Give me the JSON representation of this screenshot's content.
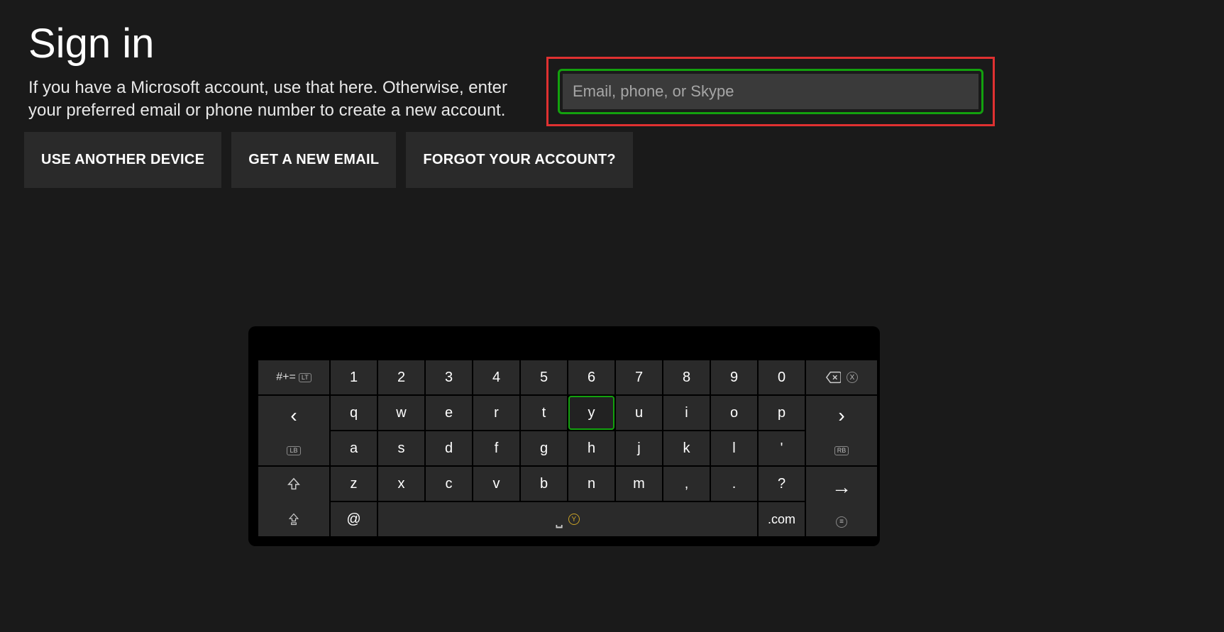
{
  "header": {
    "title": "Sign in",
    "subtitle": "If you have a Microsoft account, use that here. Otherwise, enter your preferred email or phone number to create a new account."
  },
  "buttons": {
    "another_device": "USE ANOTHER DEVICE",
    "new_email": "GET A NEW EMAIL",
    "forgot": "FORGOT YOUR ACCOUNT?"
  },
  "input": {
    "placeholder": "Email, phone, or Skype",
    "value": ""
  },
  "keyboard": {
    "symbol_mode_label": "#+=",
    "lt_badge": "LT",
    "lb_badge": "LB",
    "rb_badge": "RB",
    "x_badge": "X",
    "y_badge": "Y",
    "row1": [
      "1",
      "2",
      "3",
      "4",
      "5",
      "6",
      "7",
      "8",
      "9",
      "0"
    ],
    "row2": [
      "q",
      "w",
      "e",
      "r",
      "t",
      "y",
      "u",
      "i",
      "o",
      "p"
    ],
    "row3": [
      "a",
      "s",
      "d",
      "f",
      "g",
      "h",
      "j",
      "k",
      "l",
      "'"
    ],
    "row4": [
      "z",
      "x",
      "c",
      "v",
      "b",
      "n",
      "m",
      ",",
      ".",
      "?"
    ],
    "highlighted_key": "y",
    "at_key": "@",
    "com_key": ".com",
    "space_glyph": "⎵"
  }
}
